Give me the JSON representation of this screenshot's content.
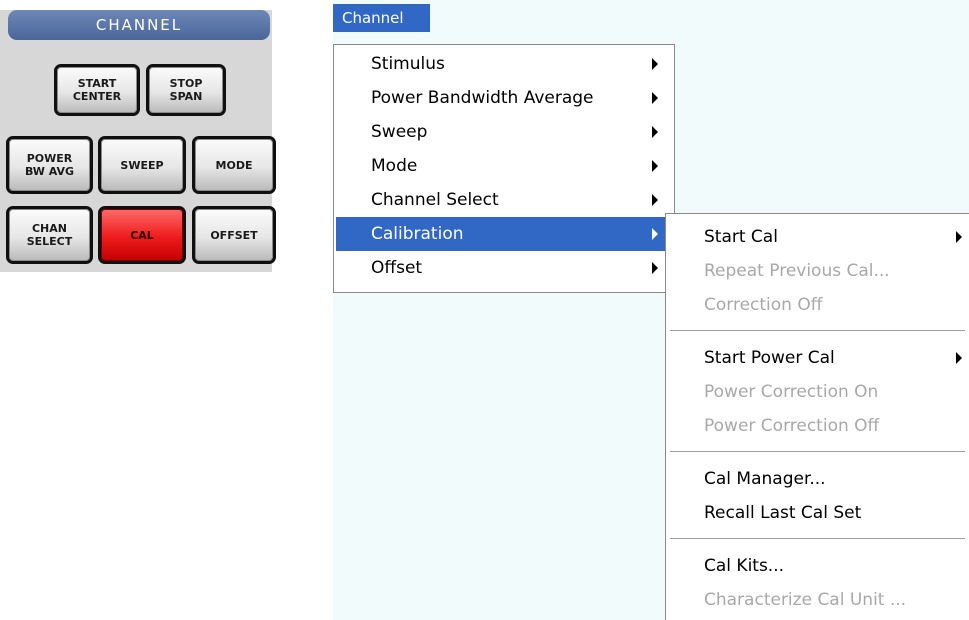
{
  "panel": {
    "title": "CHANNEL",
    "keys": [
      {
        "label": "START\nCENTER"
      },
      {
        "label": "STOP\nSPAN"
      },
      {
        "label": "POWER\nBW AVG"
      },
      {
        "label": "SWEEP"
      },
      {
        "label": "MODE"
      },
      {
        "label": "CHAN\nSELECT"
      },
      {
        "label": "CAL",
        "active": true
      },
      {
        "label": "OFFSET"
      }
    ],
    "active_color": "#e81c1c"
  },
  "menubar": {
    "title": "Channel"
  },
  "menu": {
    "items": [
      {
        "label": "Stimulus"
      },
      {
        "label": "Power Bandwidth Average"
      },
      {
        "label": "Sweep"
      },
      {
        "label": "Mode"
      },
      {
        "label": "Channel Select"
      },
      {
        "label": "Calibration",
        "selected": true
      },
      {
        "label": "Offset"
      }
    ]
  },
  "submenu": {
    "items": [
      {
        "label": "Start Cal"
      },
      {
        "label": "Repeat Previous Cal...",
        "disabled": true
      },
      {
        "label": "Correction Off",
        "disabled": true
      },
      {
        "label": "Start Power Cal"
      },
      {
        "label": "Power Correction On",
        "disabled": true
      },
      {
        "label": "Power Correction Off",
        "disabled": true
      },
      {
        "label": "Cal Manager..."
      },
      {
        "label": "Recall Last Cal Set"
      },
      {
        "label": "Cal Kits..."
      },
      {
        "label": "Characterize Cal Unit ...",
        "disabled": true
      }
    ]
  },
  "colors": {
    "highlight": "#3167c5",
    "disabled_text": "#a8a8a8",
    "background": "#f1fbfb"
  }
}
